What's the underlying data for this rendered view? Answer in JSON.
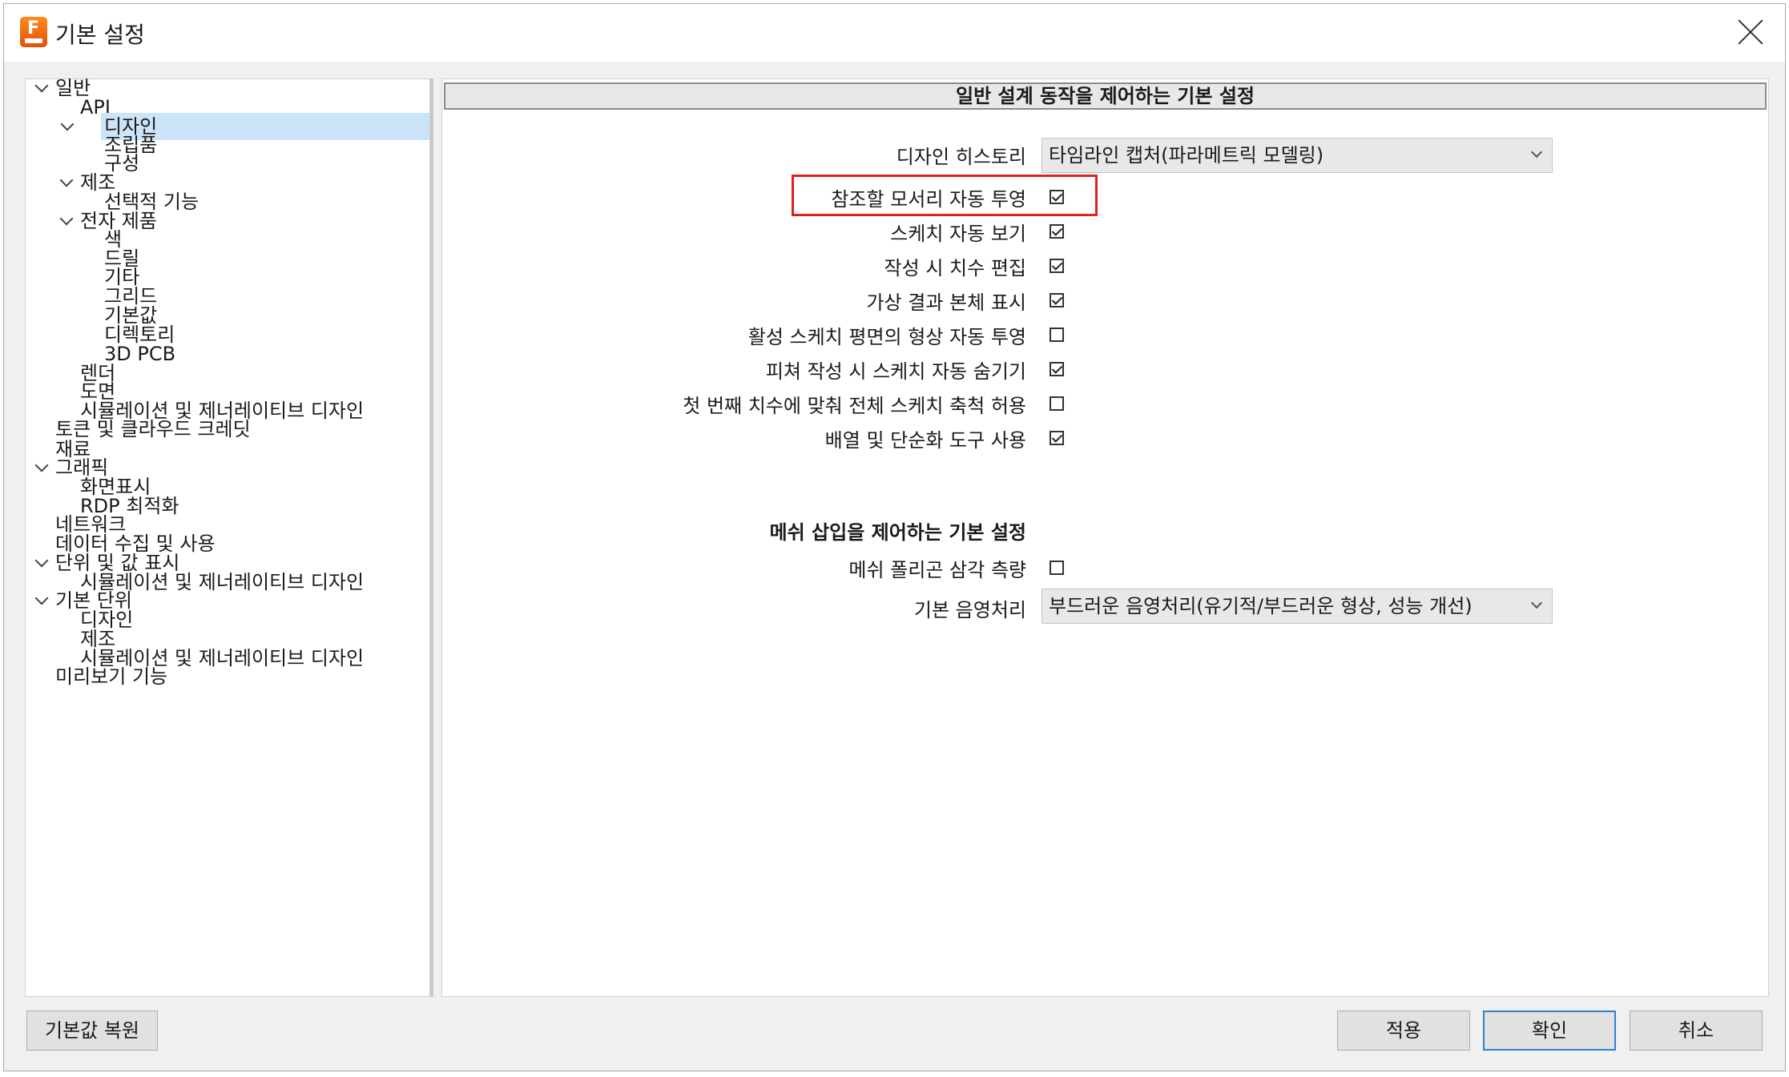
{
  "window": {
    "title": "기본 설정"
  },
  "tree": {
    "items": [
      {
        "label": "일반"
      },
      {
        "label": "API"
      },
      {
        "label": "디자인"
      },
      {
        "label": "조립품"
      },
      {
        "label": "구성"
      },
      {
        "label": "제조"
      },
      {
        "label": "선택적 기능"
      },
      {
        "label": "전자 제품"
      },
      {
        "label": "색"
      },
      {
        "label": "드릴"
      },
      {
        "label": "기타"
      },
      {
        "label": "그리드"
      },
      {
        "label": "기본값"
      },
      {
        "label": "디렉토리"
      },
      {
        "label": "3D PCB"
      },
      {
        "label": "렌더"
      },
      {
        "label": "도면"
      },
      {
        "label": "시뮬레이션 및 제너레이티브 디자인"
      },
      {
        "label": "토큰 및 클라우드 크레딧"
      },
      {
        "label": "재료"
      },
      {
        "label": "그래픽"
      },
      {
        "label": "화면표시"
      },
      {
        "label": "RDP 최적화"
      },
      {
        "label": "네트워크"
      },
      {
        "label": "데이터 수집 및 사용"
      },
      {
        "label": "단위 및 값 표시"
      },
      {
        "label": "시뮬레이션 및 제너레이티브 디자인"
      },
      {
        "label": "기본 단위"
      },
      {
        "label": "디자인"
      },
      {
        "label": "제조"
      },
      {
        "label": "시뮬레이션 및 제너레이티브 디자인"
      },
      {
        "label": "미리보기 기능"
      }
    ],
    "selected": "디자인"
  },
  "panel": {
    "header": "일반 설계 동작을 제어하는 기본 설정",
    "design_history_label": "디자인 히스토리",
    "design_history_value": "타임라인 캡처(파라메트릭 모델링)",
    "options": [
      {
        "label": "참조할 모서리 자동 투영",
        "checked": true
      },
      {
        "label": "스케치 자동 보기",
        "checked": true
      },
      {
        "label": "작성 시 치수 편집",
        "checked": true
      },
      {
        "label": "가상 결과 본체 표시",
        "checked": true
      },
      {
        "label": "활성 스케치 평면의 형상 자동 투영",
        "checked": false
      },
      {
        "label": "피쳐 작성 시 스케치 자동 숨기기",
        "checked": true
      },
      {
        "label": "첫 번째 치수에 맞춰 전체 스케치 축척 허용",
        "checked": false
      },
      {
        "label": "배열 및 단순화 도구 사용",
        "checked": true
      }
    ],
    "mesh_section_title": "메쉬 삽입을 제어하는 기본 설정",
    "mesh_option": {
      "label": "메쉬 폴리곤 삼각 측량",
      "checked": false
    },
    "shading_label": "기본 음영처리",
    "shading_value": "부드러운 음영처리(유기적/부드러운 형상, 성능 개선)"
  },
  "buttons": {
    "restore": "기본값 복원",
    "apply": "적용",
    "ok": "확인",
    "cancel": "취소"
  },
  "colors": {
    "selection": "#cce4f7",
    "highlight_box": "#e02020",
    "primary_button_border": "#2f7fd1"
  }
}
